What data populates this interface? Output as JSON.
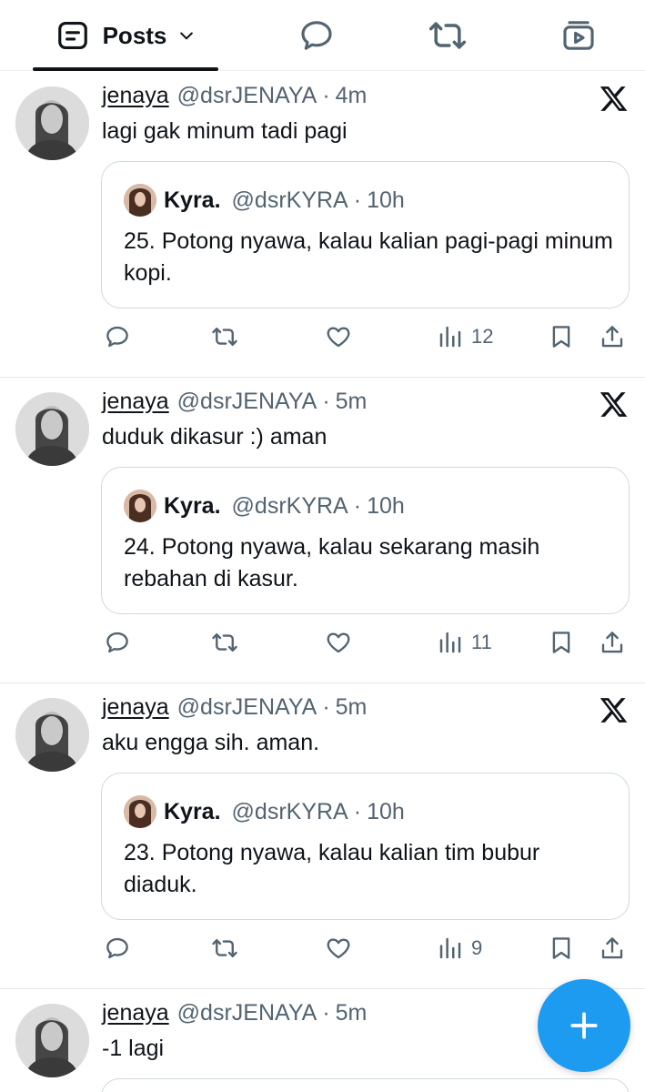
{
  "tabs": [
    {
      "label": "Posts",
      "icon": "posts-icon",
      "active": true,
      "has_dropdown": true
    },
    {
      "label": "",
      "icon": "replies-icon",
      "active": false
    },
    {
      "label": "",
      "icon": "reposts-icon",
      "active": false
    },
    {
      "label": "",
      "icon": "videos-icon",
      "active": false
    }
  ],
  "posts": [
    {
      "author": "jenaya",
      "handle": "@dsrJENAYA",
      "separator": "·",
      "time": "4m",
      "text": "lagi gak minum tadi pagi",
      "quote": {
        "author": "Kyra.",
        "handle": "@dsrKYRA",
        "separator": "·",
        "time": "10h",
        "text": "25. Potong nyawa, kalau kalian pagi-pagi minum kopi."
      },
      "views": "12"
    },
    {
      "author": "jenaya",
      "handle": "@dsrJENAYA",
      "separator": "·",
      "time": "5m",
      "text": "duduk dikasur :) aman",
      "quote": {
        "author": "Kyra.",
        "handle": "@dsrKYRA",
        "separator": "·",
        "time": "10h",
        "text": "24. Potong nyawa, kalau sekarang masih rebahan di kasur."
      },
      "views": "11"
    },
    {
      "author": "jenaya",
      "handle": "@dsrJENAYA",
      "separator": "·",
      "time": "5m",
      "text": "aku engga sih. aman.",
      "quote": {
        "author": "Kyra.",
        "handle": "@dsrKYRA",
        "separator": "·",
        "time": "10h",
        "text": "23. Potong nyawa, kalau kalian tim bubur diaduk."
      },
      "views": "9"
    },
    {
      "author": "jenaya",
      "handle": "@dsrJENAYA",
      "separator": "·",
      "time": "5m",
      "text": "-1 lagi"
    }
  ],
  "fab": {
    "icon": "plus-icon"
  },
  "colors": {
    "accent": "#1d9bf0",
    "text": "#0f1419",
    "secondary": "#536471",
    "border": "#cfd9de"
  }
}
